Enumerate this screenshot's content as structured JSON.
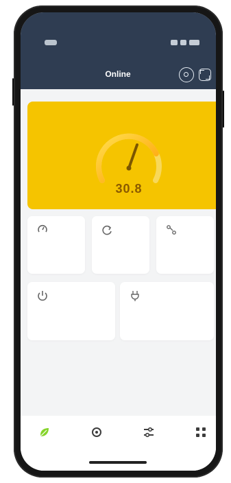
{
  "status_bar": {
    "time": "",
    "signal": "",
    "battery": ""
  },
  "header": {
    "left_label": "",
    "title": "Online"
  },
  "hero": {
    "label": "",
    "value": "30.8",
    "accent_color": "#f5c400"
  },
  "cards": {
    "small": [
      {
        "title": "",
        "subtitle": ""
      },
      {
        "title": "",
        "subtitle": ""
      },
      {
        "title": "",
        "subtitle": ""
      }
    ],
    "large": [
      {
        "title": "",
        "subtitle": ""
      },
      {
        "title": "",
        "subtitle": ""
      }
    ]
  },
  "bottom_nav": {
    "items": [
      {
        "label": "",
        "icon": "leaf-icon",
        "active": true
      },
      {
        "label": "",
        "icon": "settings-icon",
        "active": false
      },
      {
        "label": "",
        "icon": "sliders-icon",
        "active": false
      },
      {
        "label": "",
        "icon": "grid-icon",
        "active": false
      }
    ]
  }
}
